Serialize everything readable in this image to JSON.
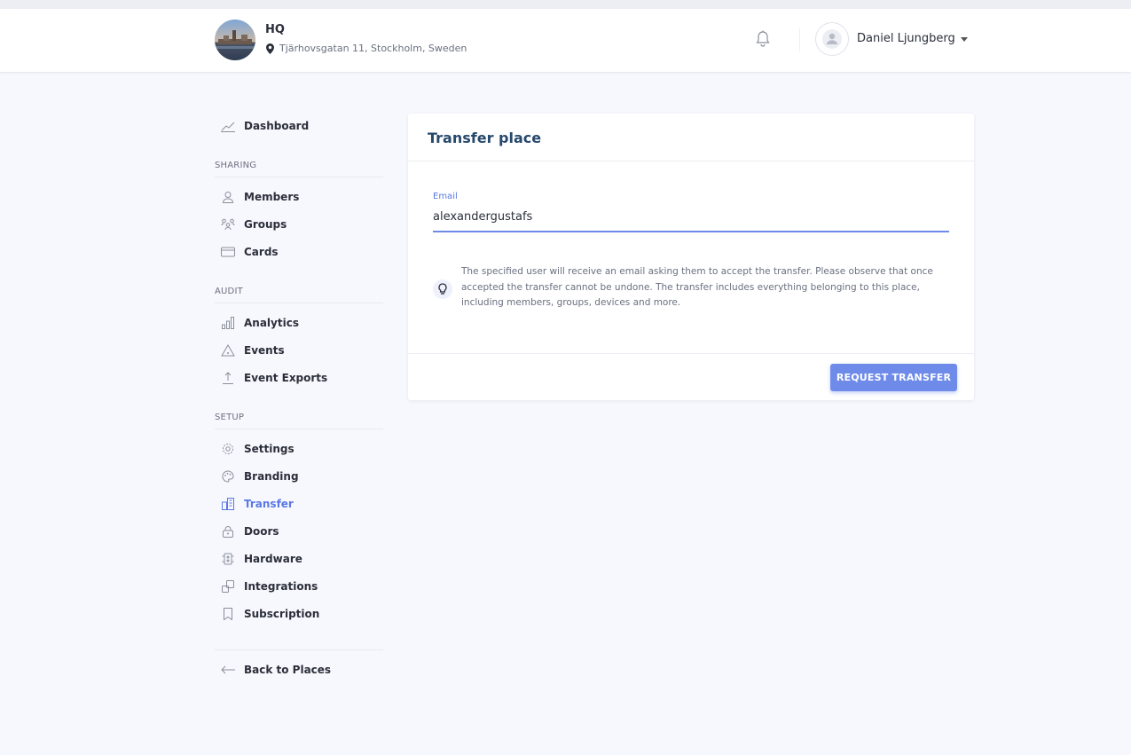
{
  "header": {
    "place_name": "HQ",
    "place_address": "Tjärhovsgatan 11, Stockholm, Sweden",
    "user_name": "Daniel Ljungberg"
  },
  "sidebar": {
    "dashboard": "Dashboard",
    "sections": {
      "sharing": "SHARING",
      "audit": "AUDIT",
      "setup": "SETUP"
    },
    "items": {
      "members": "Members",
      "groups": "Groups",
      "cards": "Cards",
      "analytics": "Analytics",
      "events": "Events",
      "event_exports": "Event Exports",
      "settings": "Settings",
      "branding": "Branding",
      "transfer": "Transfer",
      "doors": "Doors",
      "hardware": "Hardware",
      "integrations": "Integrations",
      "subscription": "Subscription"
    },
    "back": "Back to Places",
    "active_color": "#5a78e6"
  },
  "main": {
    "title": "Transfer place",
    "email_label": "Email",
    "email_value": "alexandergustafs",
    "info_text": "The specified user will receive an email asking them to accept the transfer. Please observe that once accepted the transfer cannot be undone. The transfer includes everything belonging to this place, including members, groups, devices and more.",
    "submit_label": "REQUEST TRANSFER",
    "accent_color": "#6f8bea"
  }
}
